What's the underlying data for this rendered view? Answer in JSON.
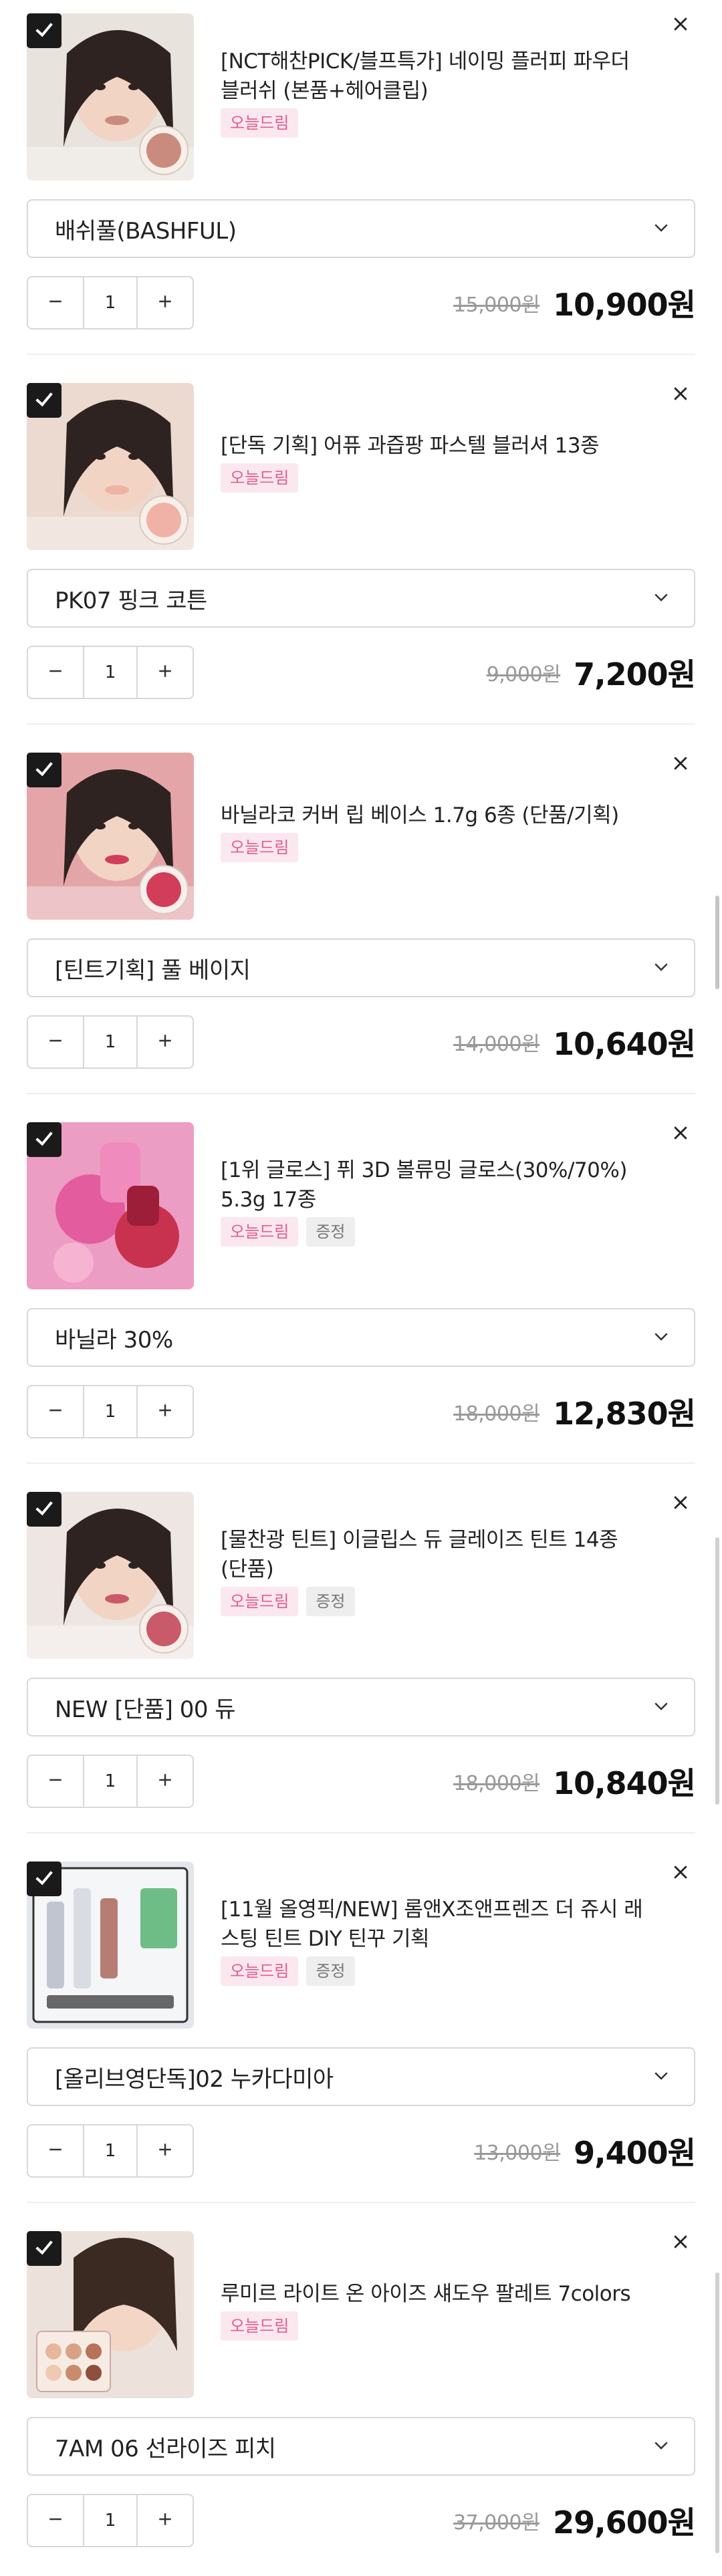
{
  "cart": {
    "items": [
      {
        "name": "[NCT해찬PICK/블프특가] 네이밍 플러피 파우더 블러쉬 (본품+헤어클립)",
        "badges": [
          "오늘드림"
        ],
        "option": "배쉬풀(BASHFUL)",
        "quantity": "1",
        "original_price": "15,000원",
        "sale_price": "10,900원",
        "thumb": {
          "bg": "#e9e3de",
          "accent": "#c98b7e",
          "icon": "blush-compact-with-model"
        }
      },
      {
        "name": "[단독 기획] 어퓨 과즙팡 파스텔 블러셔 13종",
        "badges": [
          "오늘드림"
        ],
        "option": "PK07 핑크 코튼",
        "quantity": "1",
        "original_price": "9,000원",
        "sale_price": "7,200원",
        "thumb": {
          "bg": "#ecd9cf",
          "accent": "#f0b2a6",
          "icon": "pastel-blusher-with-model"
        }
      },
      {
        "name": "바닐라코 커버 립 베이스 1.7g 6종 (단품/기획)",
        "badges": [
          "오늘드림"
        ],
        "option": "[틴트기획] 풀 베이지",
        "quantity": "1",
        "original_price": "14,000원",
        "sale_price": "10,640원",
        "thumb": {
          "bg": "#e4a5a9",
          "accent": "#d23d5a",
          "icon": "lip-base-with-model"
        }
      },
      {
        "name": "[1위 글로스] 퓌 3D 볼류밍 글로스(30%/70%) 5.3g 17종",
        "badges": [
          "오늘드림",
          "증정"
        ],
        "option": "바닐라 30%",
        "quantity": "1",
        "original_price": "18,000원",
        "sale_price": "12,830원",
        "thumb": {
          "bg": "#ec9dc4",
          "accent": "#c8324e",
          "icon": "gloss-bottles"
        }
      },
      {
        "name": "[물찬광 틴트] 이글립스 듀 글레이즈 틴트 14종 (단품)",
        "badges": [
          "오늘드림",
          "증정"
        ],
        "option": "NEW [단품] 00 듀",
        "quantity": "1",
        "original_price": "18,000원",
        "sale_price": "10,840원",
        "thumb": {
          "bg": "#eee6e2",
          "accent": "#c85a6a",
          "icon": "tint-with-model"
        }
      },
      {
        "name": "[11월 올영픽/NEW] 롬앤X조앤프렌즈 더 쥬시 래스팅 틴트 DIY 틴꾸 기획",
        "badges": [
          "오늘드림",
          "증정"
        ],
        "option": "[올리브영단독]02 누카다미아",
        "quantity": "1",
        "original_price": "13,000원",
        "sale_price": "9,400원",
        "thumb": {
          "bg": "#e3e6ea",
          "accent": "#b57d73",
          "icon": "tint-diy-kit"
        }
      },
      {
        "name": "루미르 라이트 온 아이즈 섀도우 팔레트 7colors",
        "badges": [
          "오늘드림"
        ],
        "option": "7AM 06 선라이즈 피치",
        "quantity": "1",
        "original_price": "37,000원",
        "sale_price": "29,600원",
        "thumb": {
          "bg": "#ece2db",
          "accent": "#d9a184",
          "icon": "eyeshadow-palette-with-model"
        }
      }
    ]
  },
  "colors": {
    "checkbox": "#1a1a1a",
    "badge_today_bg": "#fbe8ef",
    "badge_today_text": "#e35b8f",
    "badge_gift_bg": "#eeeeee",
    "badge_gift_text": "#777777"
  }
}
